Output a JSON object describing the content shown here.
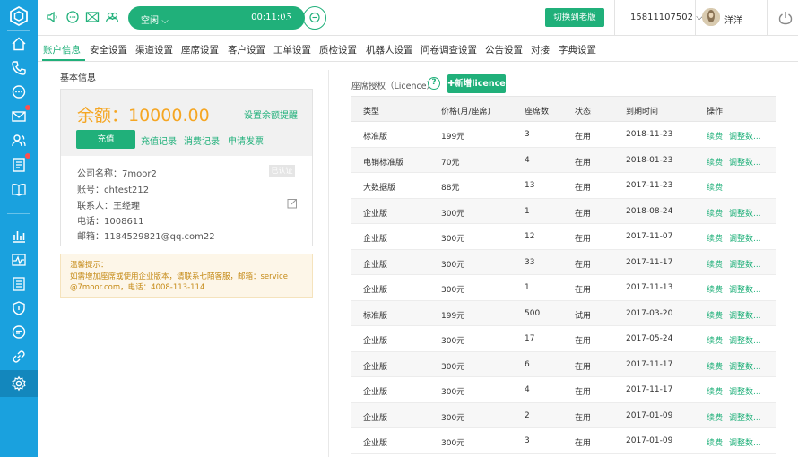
{
  "topbar": {
    "status": "空闲",
    "timer": "00:11:05",
    "switch_label": "切换到老版",
    "phone": "15811107502",
    "user_name": "洋洋"
  },
  "tabs": [
    "账户信息",
    "安全设置",
    "渠道设置",
    "座席设置",
    "客户设置",
    "工单设置",
    "质检设置",
    "机器人设置",
    "问卷调查设置",
    "公告设置",
    "对接",
    "字典设置"
  ],
  "basic": {
    "title": "基本信息",
    "balance": "余额：10000.00",
    "set_reminder": "设置余额提醒",
    "recharge": "充值",
    "recharge_records": "充值记录",
    "consume_records": "消费记录",
    "invoice": "申请发票",
    "company": "公司名称：7moor2",
    "verified": "已认证",
    "account": "账号：chtest212",
    "contact": "联系人：王经理",
    "phone": "电话：1008611",
    "email": "邮箱：1184529821@qq.com22"
  },
  "tip": {
    "title": "温馨提示：",
    "line1": "如需增加座席或使用企业版本，请联系七陌客服，邮箱：service",
    "line2": "@7moor.com，电话：4008-113-114"
  },
  "licence": {
    "title": "座席授权（Licence）",
    "help": "?",
    "add": "✚新增licence",
    "headers": [
      "类型",
      "价格(月/座席)",
      "座席数",
      "状态",
      "到期时间",
      "操作"
    ],
    "rows": [
      {
        "type": "标准版",
        "price": "199元",
        "seats": "3",
        "status": "在用",
        "expire": "2018-11-23",
        "op1": "续费",
        "op2": "调整数..."
      },
      {
        "type": "电销标准版",
        "price": "70元",
        "seats": "4",
        "status": "在用",
        "expire": "2018-01-23",
        "op1": "续费",
        "op2": "调整数..."
      },
      {
        "type": "大数据版",
        "price": "88元",
        "seats": "13",
        "status": "在用",
        "expire": "2017-11-23",
        "op1": "续费",
        "op2": ""
      },
      {
        "type": "企业版",
        "price": "300元",
        "seats": "1",
        "status": "在用",
        "expire": "2018-08-24",
        "op1": "续费",
        "op2": "调整数..."
      },
      {
        "type": "企业版",
        "price": "300元",
        "seats": "12",
        "status": "在用",
        "expire": "2017-11-07",
        "op1": "续费",
        "op2": "调整数..."
      },
      {
        "type": "企业版",
        "price": "300元",
        "seats": "33",
        "status": "在用",
        "expire": "2017-11-17",
        "op1": "续费",
        "op2": "调整数..."
      },
      {
        "type": "企业版",
        "price": "300元",
        "seats": "1",
        "status": "在用",
        "expire": "2017-11-13",
        "op1": "续费",
        "op2": "调整数..."
      },
      {
        "type": "标准版",
        "price": "199元",
        "seats": "500",
        "status": "试用",
        "expire": "2017-03-20",
        "op1": "续费",
        "op2": "调整数..."
      },
      {
        "type": "企业版",
        "price": "300元",
        "seats": "17",
        "status": "在用",
        "expire": "2017-05-24",
        "op1": "续费",
        "op2": "调整数..."
      },
      {
        "type": "企业版",
        "price": "300元",
        "seats": "6",
        "status": "在用",
        "expire": "2017-11-17",
        "op1": "续费",
        "op2": "调整数..."
      },
      {
        "type": "企业版",
        "price": "300元",
        "seats": "4",
        "status": "在用",
        "expire": "2017-11-17",
        "op1": "续费",
        "op2": "调整数..."
      },
      {
        "type": "企业版",
        "price": "300元",
        "seats": "2",
        "status": "在用",
        "expire": "2017-01-09",
        "op1": "续费",
        "op2": "调整数..."
      },
      {
        "type": "企业版",
        "price": "300元",
        "seats": "3",
        "status": "在用",
        "expire": "2017-01-09",
        "op1": "续费",
        "op2": "调整数..."
      }
    ]
  },
  "colors": {
    "accent": "#20b07a",
    "sidebar": "#1aa1de",
    "balance": "#f5a623"
  }
}
